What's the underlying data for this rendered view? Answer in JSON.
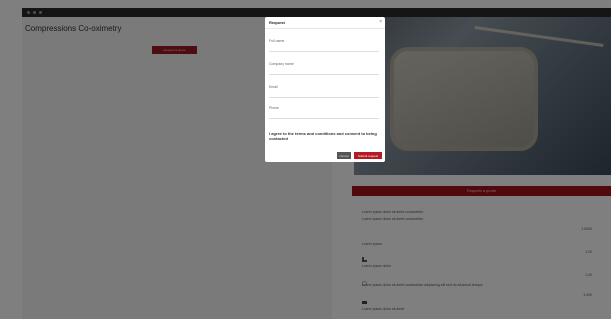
{
  "window": {
    "controls": [
      "close",
      "minimize",
      "maximize"
    ]
  },
  "page": {
    "title": "Compressions Co-oximetry",
    "action_button": "Request a quote"
  },
  "banner": {
    "text": "Request a quote"
  },
  "info": {
    "lines": [
      "Lorem ipsum dolor sit amet consectetur",
      "Lorem ipsum dolor sit amet consectetur",
      "Lorem ipsum",
      "Lorem ipsum dolor",
      "Lorem ipsum dolor sit amet",
      "Lorem ipsum dolor sit amet consectetur adipiscing elit sed do eiusmod tempor",
      "Lorem ipsum dolor sit amet"
    ],
    "values": [
      "1.0000",
      "1.00",
      "1.00",
      "1.000"
    ]
  },
  "modal": {
    "title": "Request",
    "close_glyph": "×",
    "fields": [
      {
        "label": "Full name",
        "value": ""
      },
      {
        "label": "Company name",
        "value": ""
      },
      {
        "label": "Email",
        "value": ""
      },
      {
        "label": "Phone",
        "value": ""
      }
    ],
    "consent": "I agree to the terms and conditions and consent to being contacted",
    "cancel_label": "Cancel",
    "submit_label": "Submit request"
  },
  "colors": {
    "accent": "#a3131c",
    "overlay": "#000000",
    "titlebar": "#2b2b2b"
  }
}
